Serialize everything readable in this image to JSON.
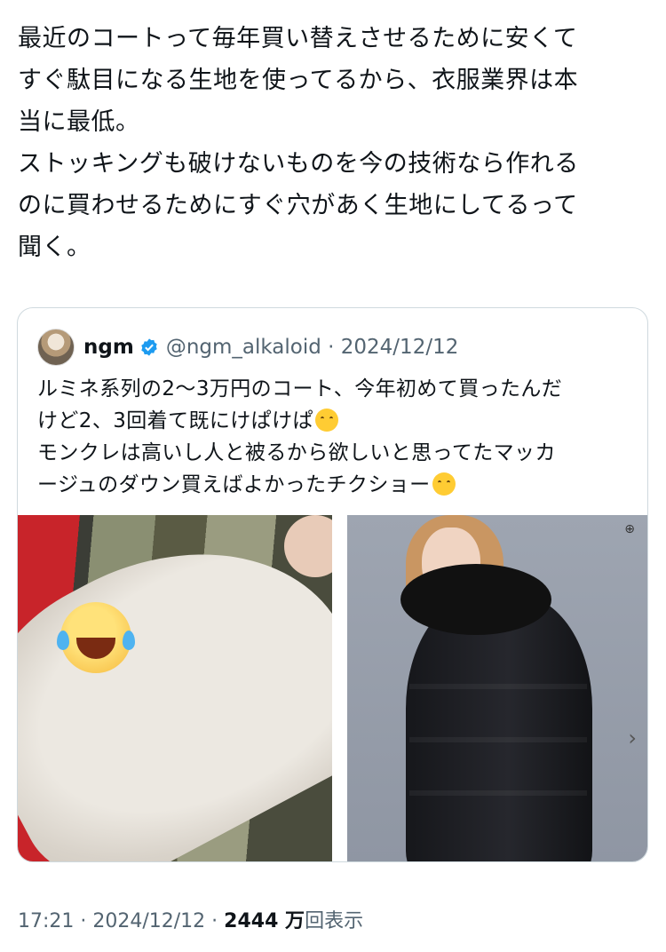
{
  "post": {
    "lines": [
      "最近のコートって毎年買い替えさせるために安くて",
      "すぐ駄目になる生地を使ってるから、衣服業界は本",
      "当に最低。",
      "ストッキングも破けないものを今の技術なら作れる",
      "のに買わせるためにすぐ穴があく生地にしてるって",
      "聞く。"
    ]
  },
  "quote": {
    "name": "ngm",
    "handle_date": "@ngm_alkaloid · 2024/12/12",
    "line1": "ルミネ系列の2〜3万円のコート、今年初めて買ったんだ",
    "line2": "けど2、3回着て既にけぱけぱ",
    "line3": "モンクレは高いし人と被るから欲しいと思ってたマッカ",
    "line4": "ージュのダウン買えばよかったチクショー"
  },
  "icons": {
    "verified": "verified-badge-icon",
    "zoom": "zoom-icon",
    "next": "chevron-right-icon"
  },
  "footer": {
    "time_date": "17:21 · 2024/12/12 · ",
    "views": "2444 万",
    "views_label": "回表示"
  },
  "colors": {
    "text": "#0f1419",
    "secondary": "#536471",
    "verified": "#1d9bf0",
    "border": "#cfd9de"
  }
}
